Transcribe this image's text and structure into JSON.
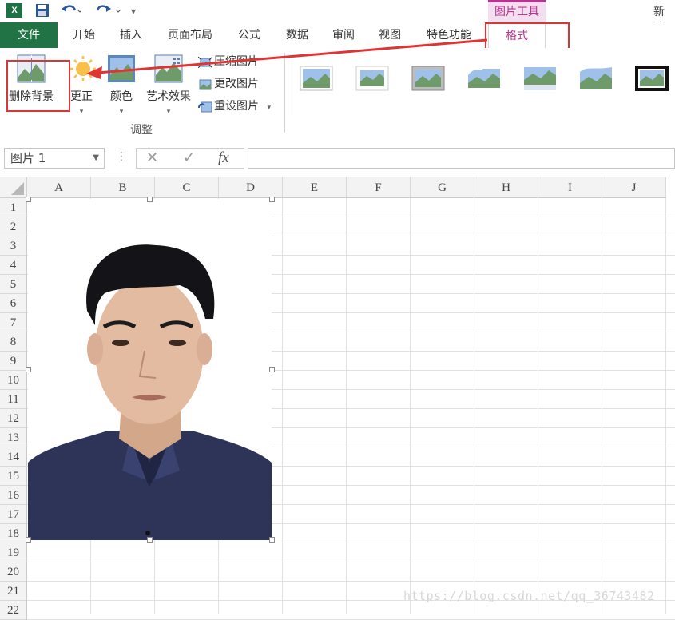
{
  "title_bar": {
    "app_icon": "excel-icon",
    "context_tool_label": "图片工具",
    "doc_title_partial": "新建"
  },
  "tabs": [
    {
      "label": "文件"
    },
    {
      "label": "开始"
    },
    {
      "label": "插入"
    },
    {
      "label": "页面布局"
    },
    {
      "label": "公式"
    },
    {
      "label": "数据"
    },
    {
      "label": "审阅"
    },
    {
      "label": "视图"
    },
    {
      "label": "特色功能"
    },
    {
      "label": "格式",
      "active": true
    }
  ],
  "ribbon": {
    "remove_bg_label": "删除背景",
    "correct_label": "更正",
    "color_label": "颜色",
    "artistic_label": "艺术效果",
    "compress_label": "压缩图片",
    "change_label": "更改图片",
    "reset_label": "重设图片",
    "group_label": "调整",
    "accent": "#b5358f",
    "highlight": "#e03434"
  },
  "formula_bar": {
    "name_box": "图片 1",
    "cancel_symbol": "✕",
    "enter_symbol": "✓",
    "fx_symbol": "fx",
    "value": ""
  },
  "grid": {
    "columns": [
      "A",
      "B",
      "C",
      "D",
      "E",
      "F",
      "G",
      "H",
      "I",
      "J"
    ],
    "rows": [
      "1",
      "2",
      "3",
      "4",
      "5",
      "6",
      "7",
      "8",
      "9",
      "10",
      "11",
      "12",
      "13",
      "14",
      "15",
      "16",
      "17",
      "18",
      "19",
      "20",
      "21",
      "22"
    ]
  },
  "watermark": "https://blog.csdn.net/qq_36743482"
}
